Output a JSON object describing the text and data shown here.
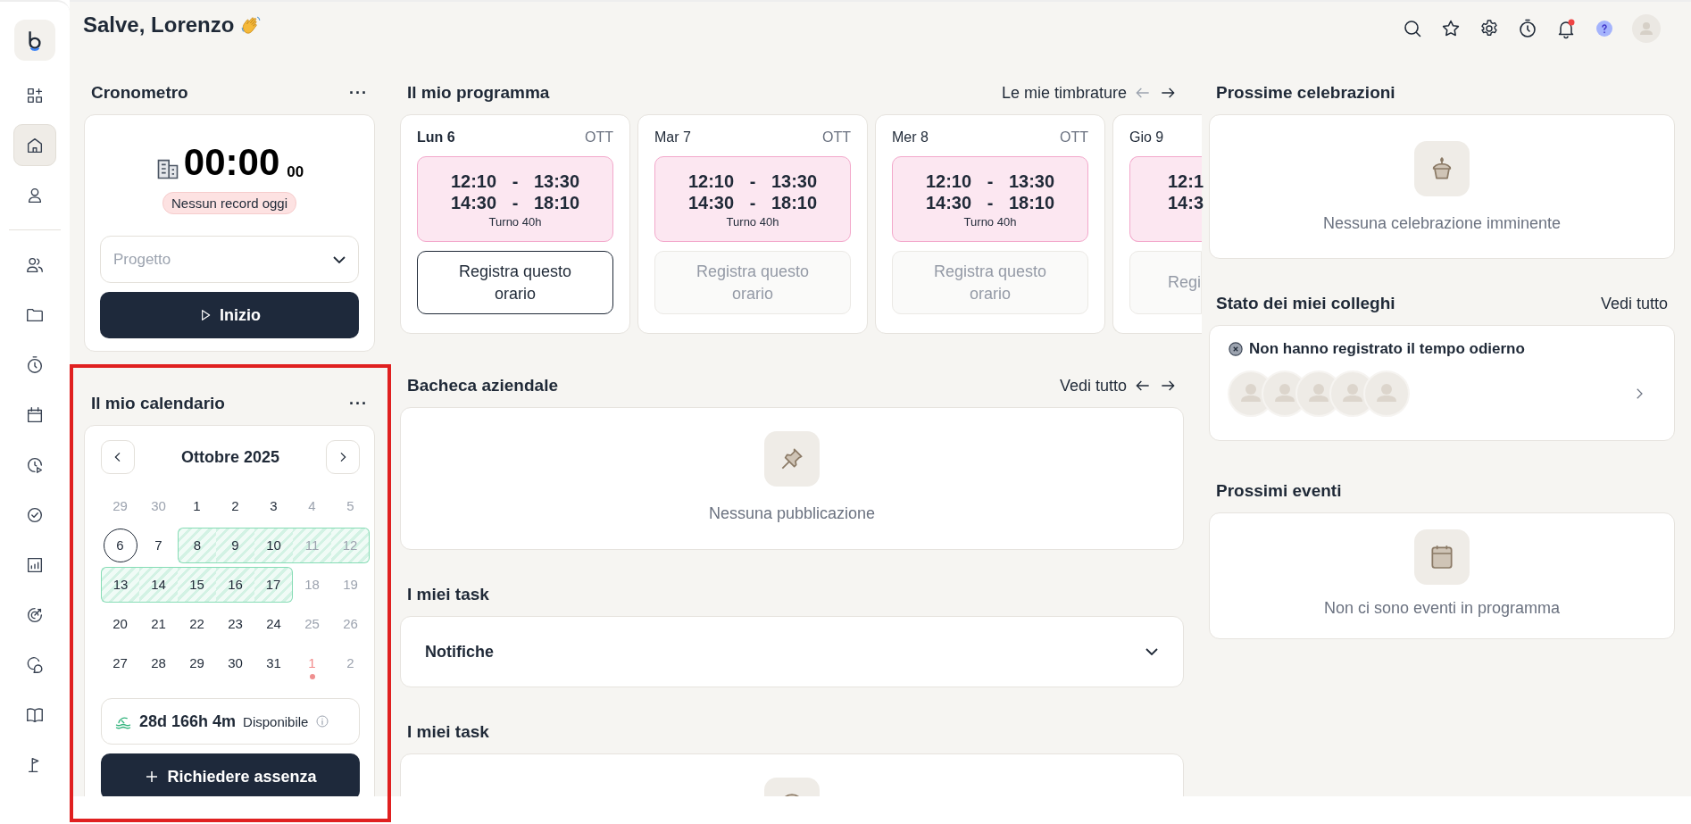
{
  "greeting": "Salve, Lorenzo",
  "sidebar": {
    "top": [
      {
        "selected": false
      },
      {
        "selected": true
      },
      {
        "selected": false
      }
    ],
    "bottom": [
      {
        "selected": false
      },
      {
        "selected": false
      },
      {
        "selected": false
      },
      {
        "selected": false
      },
      {
        "selected": false
      },
      {
        "selected": false
      },
      {
        "selected": false
      },
      {
        "selected": false
      },
      {
        "selected": false
      },
      {
        "selected": false
      },
      {
        "selected": false
      }
    ]
  },
  "toolbar": {
    "notifications_unread": true
  },
  "stopwatch": {
    "title": "Cronometro",
    "more": "···",
    "time": "00:00",
    "seconds": "00",
    "status": "Nessun record oggi",
    "project_placeholder": "Progetto",
    "start_button": "Inizio"
  },
  "calendar": {
    "title": "Il mio calendario",
    "more": "···",
    "month": "Ottobre 2025",
    "days": [
      {
        "label": "29",
        "faded": true,
        "today": false,
        "leave": false,
        "holiday": false
      },
      {
        "label": "30",
        "faded": true,
        "today": false,
        "leave": false,
        "holiday": false
      },
      {
        "label": "1",
        "faded": false,
        "today": false,
        "leave": false,
        "holiday": false
      },
      {
        "label": "2",
        "faded": false,
        "today": false,
        "leave": false,
        "holiday": false
      },
      {
        "label": "3",
        "faded": false,
        "today": false,
        "leave": false,
        "holiday": false
      },
      {
        "label": "4",
        "faded": true,
        "today": false,
        "leave": false,
        "holiday": false
      },
      {
        "label": "5",
        "faded": true,
        "today": false,
        "leave": false,
        "holiday": false
      },
      {
        "label": "6",
        "faded": false,
        "today": true,
        "leave": false,
        "holiday": false
      },
      {
        "label": "7",
        "faded": false,
        "today": false,
        "leave": false,
        "holiday": false
      },
      {
        "label": "8",
        "faded": false,
        "today": false,
        "leave": true,
        "holiday": false
      },
      {
        "label": "9",
        "faded": false,
        "today": false,
        "leave": true,
        "holiday": false
      },
      {
        "label": "10",
        "faded": false,
        "today": false,
        "leave": true,
        "holiday": false
      },
      {
        "label": "11",
        "faded": true,
        "today": false,
        "leave": true,
        "holiday": false
      },
      {
        "label": "12",
        "faded": true,
        "today": false,
        "leave": true,
        "holiday": false
      },
      {
        "label": "13",
        "faded": false,
        "today": false,
        "leave": true,
        "holiday": false
      },
      {
        "label": "14",
        "faded": false,
        "today": false,
        "leave": true,
        "holiday": false
      },
      {
        "label": "15",
        "faded": false,
        "today": false,
        "leave": true,
        "holiday": false
      },
      {
        "label": "16",
        "faded": false,
        "today": false,
        "leave": true,
        "holiday": false
      },
      {
        "label": "17",
        "faded": false,
        "today": false,
        "leave": true,
        "holiday": false
      },
      {
        "label": "18",
        "faded": true,
        "today": false,
        "leave": false,
        "holiday": false
      },
      {
        "label": "19",
        "faded": true,
        "today": false,
        "leave": false,
        "holiday": false
      },
      {
        "label": "20",
        "faded": false,
        "today": false,
        "leave": false,
        "holiday": false
      },
      {
        "label": "21",
        "faded": false,
        "today": false,
        "leave": false,
        "holiday": false
      },
      {
        "label": "22",
        "faded": false,
        "today": false,
        "leave": false,
        "holiday": false
      },
      {
        "label": "23",
        "faded": false,
        "today": false,
        "leave": false,
        "holiday": false
      },
      {
        "label": "24",
        "faded": false,
        "today": false,
        "leave": false,
        "holiday": false
      },
      {
        "label": "25",
        "faded": true,
        "today": false,
        "leave": false,
        "holiday": false
      },
      {
        "label": "26",
        "faded": true,
        "today": false,
        "leave": false,
        "holiday": false
      },
      {
        "label": "27",
        "faded": false,
        "today": false,
        "leave": false,
        "holiday": false
      },
      {
        "label": "28",
        "faded": false,
        "today": false,
        "leave": false,
        "holiday": false
      },
      {
        "label": "29",
        "faded": false,
        "today": false,
        "leave": false,
        "holiday": false
      },
      {
        "label": "30",
        "faded": false,
        "today": false,
        "leave": false,
        "holiday": false
      },
      {
        "label": "31",
        "faded": false,
        "today": false,
        "leave": false,
        "holiday": false
      },
      {
        "label": "1",
        "faded": false,
        "today": false,
        "leave": false,
        "holiday": true
      },
      {
        "label": "2",
        "faded": true,
        "today": false,
        "leave": false,
        "holiday": false
      }
    ],
    "balance": "28d 166h 4m",
    "balance_label": "Disponibile",
    "request_button": "Richiedere assenza"
  },
  "schedule": {
    "title": "Il mio programma",
    "link": "Le mie timbrature",
    "days": [
      {
        "kind": "full",
        "day": "Lun 6",
        "month": "OTT",
        "current": true,
        "slots": [
          "12:10 - 13:30",
          "14:30 - 18:10"
        ],
        "shift": "Turno 40h",
        "button": "Registra questo orario",
        "disabled": false
      },
      {
        "kind": "full",
        "day": "Mar 7",
        "month": "OTT",
        "current": false,
        "slots": [
          "12:10 - 13:30",
          "14:30 - 18:10"
        ],
        "shift": "Turno 40h",
        "button": "Registra questo orario",
        "disabled": true
      },
      {
        "kind": "full",
        "day": "Mer 8",
        "month": "OTT",
        "current": false,
        "slots": [
          "12:10 - 13:30",
          "14:30 - 18:10"
        ],
        "shift": "Turno 40h",
        "button": "Registra questo orario",
        "disabled": true
      },
      {
        "kind": "partial",
        "day": "Gio 9",
        "slots": [
          "12:1",
          "14:3"
        ],
        "button": "Regi",
        "disabled": true
      }
    ]
  },
  "board": {
    "title": "Bacheca aziendale",
    "link": "Vedi tutto",
    "empty": "Nessuna pubblicazione"
  },
  "tasks": {
    "title": "I miei task",
    "section": "Notifiche",
    "expanded": false
  },
  "tasks_2": {
    "title": "I miei task"
  },
  "celebrations": {
    "title": "Prossime celebrazioni",
    "empty": "Nessuna celebrazione imminente"
  },
  "colleagues": {
    "title": "Stato dei miei colleghi",
    "link": "Vedi tutto",
    "status": "Non hanno registrato il tempo odierno",
    "avatars": [
      {
        "kind": "placeholder"
      },
      {
        "kind": "placeholder"
      },
      {
        "kind": "placeholder"
      },
      {
        "kind": "placeholder"
      },
      {
        "kind": "placeholder"
      }
    ]
  },
  "events": {
    "title": "Prossimi eventi",
    "empty": "Non ci sono eventi in programma"
  }
}
